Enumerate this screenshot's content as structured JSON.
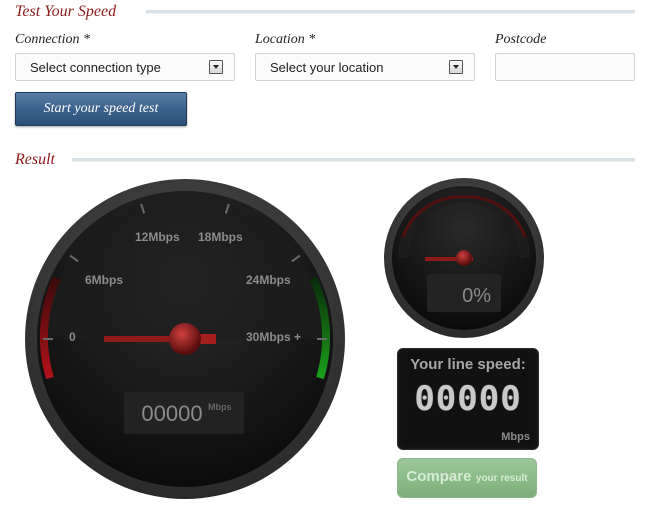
{
  "sections": {
    "test_title": "Test Your Speed",
    "result_title": "Result"
  },
  "form": {
    "connection": {
      "label": "Connection *",
      "value": "Select connection type"
    },
    "location": {
      "label": "Location *",
      "value": "Select your location"
    },
    "postcode": {
      "label": "Postcode",
      "value": ""
    },
    "start_button": "Start your speed test"
  },
  "main_gauge": {
    "tick_labels": [
      "0",
      "6Mbps",
      "12Mbps",
      "18Mbps",
      "24Mbps",
      "30Mbps +"
    ],
    "readout": "00000",
    "readout_unit": "Mbps",
    "needle_value_mbps": 0,
    "arc_colors": {
      "low": "#b3121b",
      "high": "#1aa11a"
    }
  },
  "progress_gauge": {
    "readout": "0%",
    "progress_percent": 0
  },
  "line_speed": {
    "title": "Your line speed:",
    "digits": "00000",
    "unit": "Mbps"
  },
  "compare": {
    "label": "Compare",
    "sublabel": "your result"
  }
}
